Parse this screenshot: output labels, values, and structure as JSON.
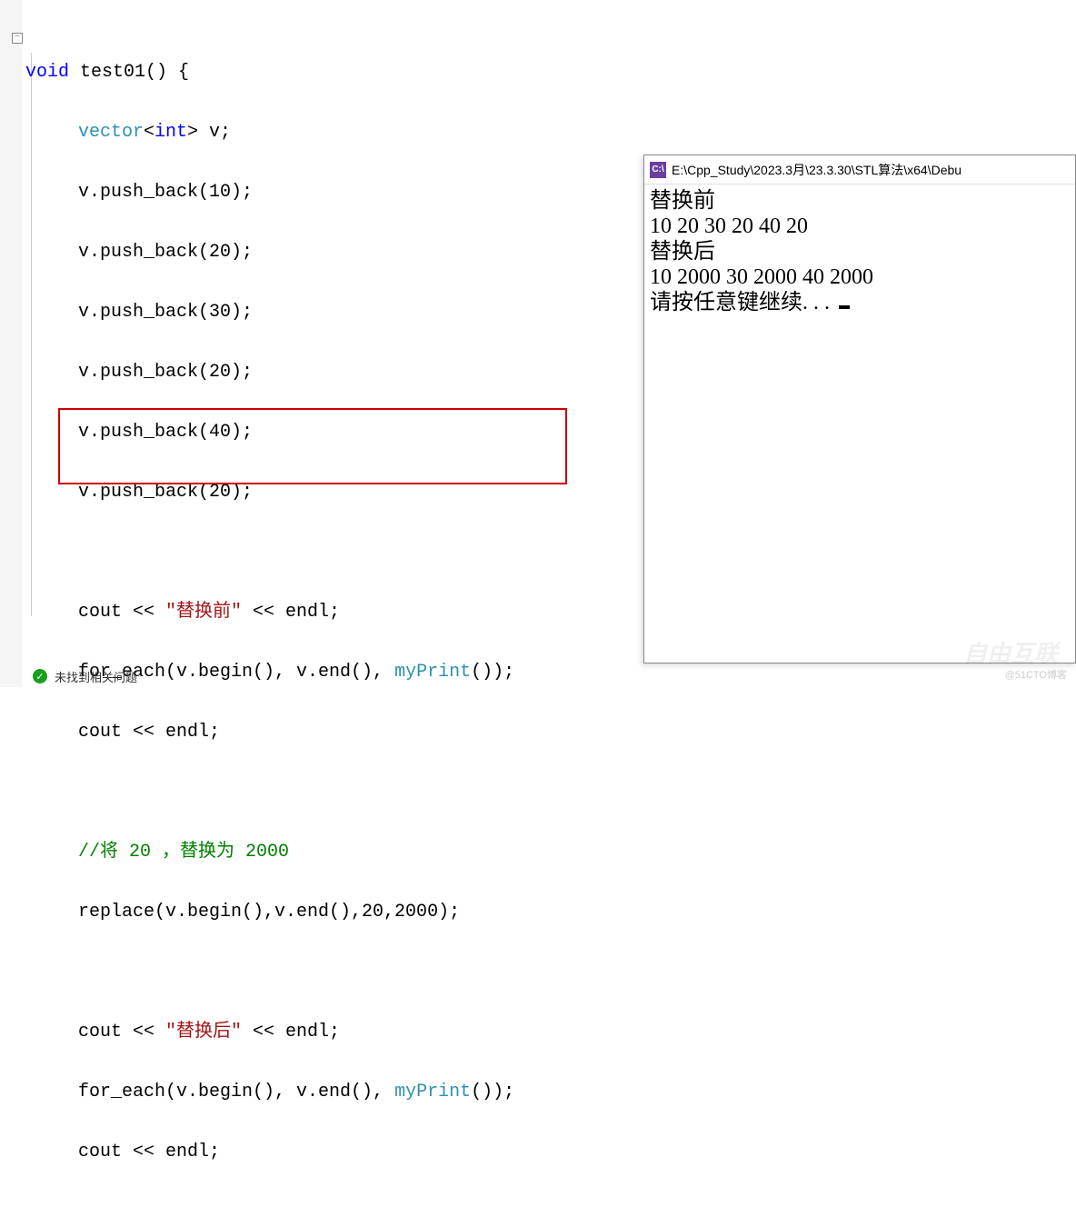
{
  "code": {
    "fn_decl_void": "void",
    "fn_decl_rest": " test01() {",
    "l2a": "vector",
    "l2b": "<",
    "l2c": "int",
    "l2d": "> v;",
    "pb1": "v.push_back(10);",
    "pb2": "v.push_back(20);",
    "pb3": "v.push_back(30);",
    "pb4": "v.push_back(20);",
    "pb5": "v.push_back(40);",
    "pb6": "v.push_back(20);",
    "cout1a": "cout << ",
    "cout1b": "\"替换前\"",
    "cout1c": " << endl;",
    "fe1a": "for_each(v.begin(), v.end(), ",
    "fe1b": "myPrint",
    "fe1c": "());",
    "endl1": "cout << endl;",
    "comment": "//将 20 ，替换为 2000",
    "replace_call": "replace(v.begin(),v.end(),20,2000);",
    "cout2a": "cout << ",
    "cout2b": "\"替换后\"",
    "cout2c": " << endl;",
    "fe2a": "for_each(v.begin(), v.end(), ",
    "fe2b": "myPrint",
    "fe2c": "());",
    "endl2": "cout << endl;",
    "fold_sym": "−"
  },
  "console": {
    "title": " E:\\Cpp_Study\\2023.3月\\23.3.30\\STL算法\\x64\\Debu",
    "icon_text": "C:\\",
    "line1": "替换前",
    "line2": "10 20 30 20 40 20",
    "line3": "替换后",
    "line4": "10 2000 30 2000 40 2000",
    "line5": "请按任意键继续. . . "
  },
  "status": {
    "text": "未找到相关问题",
    "check": "✓"
  },
  "watermark": {
    "small": "@51CTO博客",
    "big": "自由互联"
  }
}
